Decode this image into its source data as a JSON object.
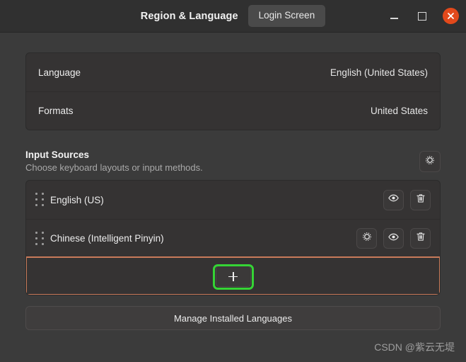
{
  "window": {
    "title": "Region & Language",
    "login_screen_button": "Login Screen",
    "controls": {
      "minimize": "minimize-icon",
      "maximize": "maximize-icon",
      "close": "close-icon"
    }
  },
  "locale_card": {
    "rows": [
      {
        "label": "Language",
        "value": "English (United States)"
      },
      {
        "label": "Formats",
        "value": "United States"
      }
    ]
  },
  "input_sources": {
    "title": "Input Sources",
    "subtitle": "Choose keyboard layouts or input methods.",
    "settings_icon": "gear-icon",
    "items": [
      {
        "name": "English (US)",
        "drag_handle": "drag-handle-icon",
        "actions": [
          {
            "icon": "eye-icon",
            "name": "preview-layout-button"
          },
          {
            "icon": "trash-icon",
            "name": "remove-source-button"
          }
        ]
      },
      {
        "name": "Chinese (Intelligent Pinyin)",
        "drag_handle": "drag-handle-icon",
        "actions": [
          {
            "icon": "gear-icon",
            "name": "source-preferences-button"
          },
          {
            "icon": "eye-icon",
            "name": "preview-layout-button"
          },
          {
            "icon": "trash-icon",
            "name": "remove-source-button"
          }
        ]
      }
    ],
    "add_button": {
      "icon": "plus-icon",
      "label": "+"
    }
  },
  "manage_languages_button": "Manage Installed Languages",
  "watermark": "CSDN @紫云无堤",
  "colors": {
    "page_background": "#3b3b3b",
    "titlebar_background": "#303030",
    "card_background": "#353333",
    "focus_border": "#c87a5a",
    "highlight_green": "#35d435",
    "close_button": "#e2491b"
  }
}
